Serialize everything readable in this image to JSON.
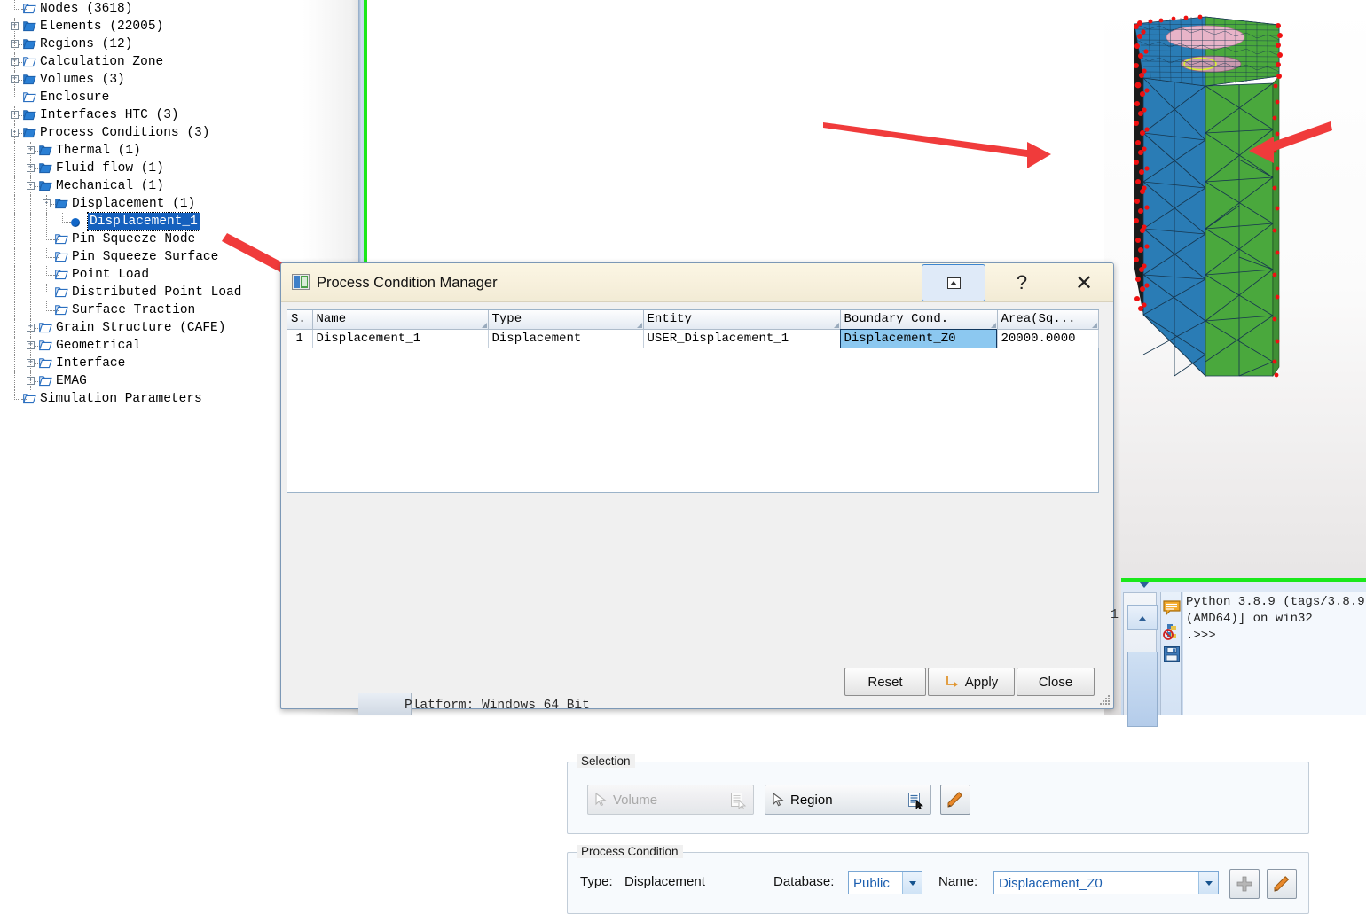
{
  "tree": {
    "items": [
      {
        "label": "Nodes  (3618)",
        "indent": 0,
        "twisty": "",
        "folder": "open",
        "leafline": true
      },
      {
        "label": "Elements  (22005)",
        "indent": 0,
        "twisty": "+",
        "folder": "closed",
        "leafline": false
      },
      {
        "label": "Regions  (12)",
        "indent": 0,
        "twisty": "+",
        "folder": "closed",
        "leafline": false
      },
      {
        "label": "Calculation Zone",
        "indent": 0,
        "twisty": "+",
        "folder": "open",
        "leafline": false
      },
      {
        "label": "Volumes  (3)",
        "indent": 0,
        "twisty": "+",
        "folder": "closed",
        "leafline": false
      },
      {
        "label": "Enclosure",
        "indent": 0,
        "twisty": "",
        "folder": "open",
        "leafline": true
      },
      {
        "label": "Interfaces HTC  (3)",
        "indent": 0,
        "twisty": "+",
        "folder": "closed",
        "leafline": false
      },
      {
        "label": "Process Conditions  (3)",
        "indent": 0,
        "twisty": "-",
        "folder": "closed",
        "leafline": false
      },
      {
        "label": "Thermal  (1)",
        "indent": 1,
        "twisty": "+",
        "folder": "closed",
        "leafline": false
      },
      {
        "label": "Fluid  flow  (1)",
        "indent": 1,
        "twisty": "+",
        "folder": "closed",
        "leafline": false
      },
      {
        "label": "Mechanical  (1)",
        "indent": 1,
        "twisty": "-",
        "folder": "closed",
        "leafline": false
      },
      {
        "label": "Displacement  (1)",
        "indent": 2,
        "twisty": "-",
        "folder": "closed",
        "leafline": false
      },
      {
        "label": "Displacement_1",
        "indent": 3,
        "twisty": "",
        "folder": "bullet",
        "leafline": true,
        "selected": true
      },
      {
        "label": "Pin Squeeze Node",
        "indent": 2,
        "twisty": "",
        "folder": "open",
        "leafline": true
      },
      {
        "label": "Pin Squeeze Surface",
        "indent": 2,
        "twisty": "",
        "folder": "open",
        "leafline": true
      },
      {
        "label": "Point Load",
        "indent": 2,
        "twisty": "",
        "folder": "open",
        "leafline": true
      },
      {
        "label": "Distributed Point Load",
        "indent": 2,
        "twisty": "",
        "folder": "open",
        "leafline": true
      },
      {
        "label": "Surface Traction",
        "indent": 2,
        "twisty": "",
        "folder": "open",
        "leafline": true
      },
      {
        "label": "Grain Structure  (CAFE)",
        "indent": 1,
        "twisty": "+",
        "folder": "open",
        "leafline": false
      },
      {
        "label": "Geometrical",
        "indent": 1,
        "twisty": "+",
        "folder": "open",
        "leafline": false
      },
      {
        "label": "Interface",
        "indent": 1,
        "twisty": "+",
        "folder": "open",
        "leafline": false
      },
      {
        "label": "EMAG",
        "indent": 1,
        "twisty": "+",
        "folder": "open",
        "leafline": false
      },
      {
        "label": "Simulation Parameters",
        "indent": 0,
        "twisty": "",
        "folder": "open",
        "leafline": true
      }
    ]
  },
  "dialog": {
    "title": "Process Condition Manager",
    "title_icon": "window-icon",
    "restore_icon": "restore-window-icon",
    "help_label": "?",
    "close_label": "✕",
    "table": {
      "headers": [
        "S.",
        "Name",
        "Type",
        "Entity",
        "Boundary Cond.",
        "Area(Sq..."
      ],
      "rows": [
        {
          "sn": "1",
          "name": "Displacement_1",
          "type": "Displacement",
          "entity": "USER_Displacement_1",
          "boundary_cond": "Displacement_Z0",
          "area": "20000.0000",
          "selected_cell": "boundary_cond"
        }
      ]
    },
    "selection": {
      "legend": "Selection",
      "volume_label": "Volume",
      "volume_enabled": false,
      "region_label": "Region",
      "region_enabled": true,
      "edit_icon": "pencil-icon"
    },
    "process_condition": {
      "legend": "Process Condition",
      "type_label": "Type:",
      "type_value": "Displacement",
      "database_label": "Database:",
      "database_value": "Public",
      "name_label": "Name:",
      "name_value": "Displacement_Z0",
      "add_icon": "plus-icon",
      "edit_icon": "pencil-icon"
    },
    "buttons": {
      "reset": "Reset",
      "apply": "Apply",
      "apply_icon": "arrow-turn-icon",
      "close": "Close"
    }
  },
  "console": {
    "platform_line": "Platform: Windows 64 Bit",
    "python_text": "Python 3.8.9 (tags/3.8.9\n(AMD64)] on win32\n.>>>",
    "line_number": "1",
    "icons": [
      "comment-icon",
      "python-stop-icon",
      "save-icon"
    ]
  },
  "viewport": {
    "annotation_arrows": 3,
    "arrow_color": "#f03b3b",
    "region_colors": {
      "blue": "#2a7cb5",
      "green": "#4aa83d",
      "pink": "#e8b4c8",
      "node": "#ee1111"
    }
  }
}
